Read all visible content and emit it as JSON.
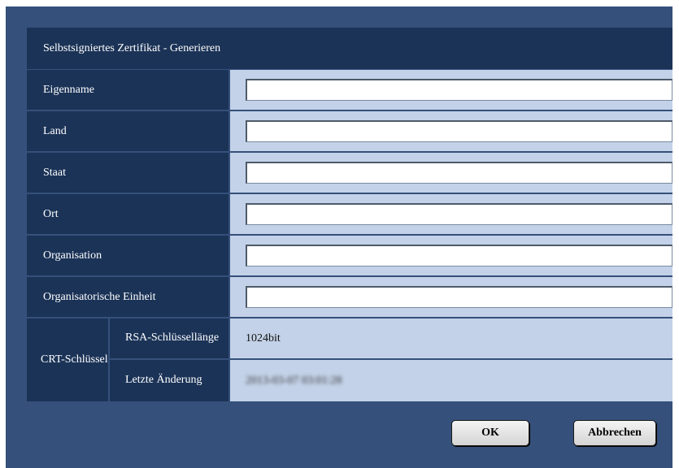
{
  "dialog": {
    "title": "Selbstsigniertes Zertifikat - Generieren",
    "fields": [
      {
        "label": "Eigenname",
        "value": ""
      },
      {
        "label": "Land",
        "value": ""
      },
      {
        "label": "Staat",
        "value": ""
      },
      {
        "label": "Ort",
        "value": ""
      },
      {
        "label": "Organisation",
        "value": ""
      },
      {
        "label": "Organisatorische Einheit",
        "value": ""
      }
    ],
    "crt_key": {
      "label": "CRT-Schlüssel",
      "rsa_label": "RSA-Schlüssellänge",
      "rsa_value": "1024bit",
      "last_change_label": "Letzte Änderung",
      "last_change_value": "2013-03-07 03:01:28"
    },
    "buttons": {
      "ok": "OK",
      "cancel": "Abbrechen"
    }
  },
  "colors": {
    "background": "#35507a",
    "header": "#1b3357",
    "value_cell": "#c3d2e8"
  }
}
